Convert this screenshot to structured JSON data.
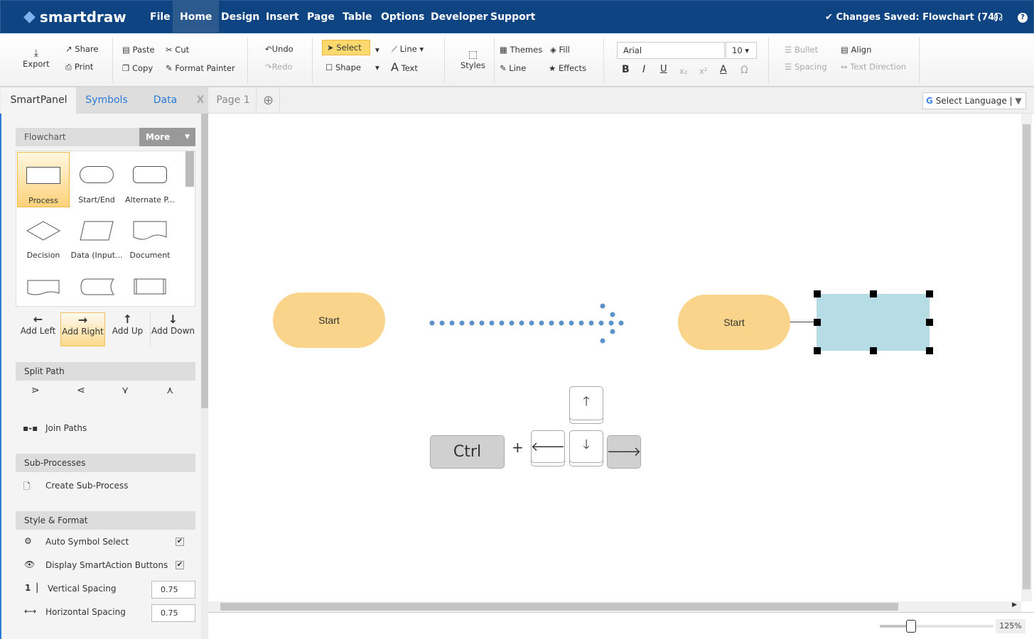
{
  "header": {
    "app_name": "smartdraw",
    "menu": [
      "File",
      "Home",
      "Design",
      "Insert",
      "Page",
      "Table",
      "Options",
      "Developer",
      "Support"
    ],
    "active_menu": "Home",
    "status": "Changes Saved: Flowchart (74)"
  },
  "toolbar": {
    "export": "Export",
    "share": "Share",
    "print": "Print",
    "paste": "Paste",
    "cut": "Cut",
    "copy": "Copy",
    "format_painter": "Format Painter",
    "undo": "Undo",
    "redo": "Redo",
    "select": "Select",
    "line": "Line",
    "shape": "Shape",
    "text": "Text",
    "styles": "Styles",
    "themes": "Themes",
    "fill": "Fill",
    "line2": "Line",
    "effects": "Effects",
    "font": "Arial",
    "size": "10",
    "bold": "B",
    "italic": "I",
    "underline": "U",
    "bullet": "Bullet",
    "align": "Align",
    "spacing": "Spacing",
    "text_direction": "Text Direction"
  },
  "tabs": {
    "smartpanel": "SmartPanel",
    "symbols": "Symbols",
    "data": "Data",
    "close": "X",
    "page": "Page 1",
    "language": "Select Language"
  },
  "panel": {
    "library": "Flowchart",
    "more": "More",
    "shapes": [
      "Process",
      "Start/End",
      "Alternate P...",
      "Decision",
      "Data (Input...",
      "Document"
    ],
    "add": [
      "Add Left",
      "Add Right",
      "Add Up",
      "Add Down"
    ],
    "split_path": "Split Path",
    "join_paths": "Join Paths",
    "sub_processes": "Sub-Processes",
    "create_sub": "Create Sub-Process",
    "style_format": "Style & Format",
    "auto_symbol": "Auto Symbol Select",
    "display_smart": "Display SmartAction Buttons",
    "vertical_spacing": "Vertical Spacing",
    "horizontal_spacing": "Horizontal Spacing",
    "vertical_value": "0.75",
    "horizontal_value": "0.75"
  },
  "canvas": {
    "start1": "Start",
    "start2": "Start",
    "ctrl": "Ctrl",
    "plus": "+"
  },
  "zoom": {
    "label": "125%",
    "value": 125
  },
  "colors": {
    "header": "#0f4482",
    "start_fill": "#f9d48a",
    "selected_fill": "#b6dce6",
    "dots": "#5b93c9"
  }
}
